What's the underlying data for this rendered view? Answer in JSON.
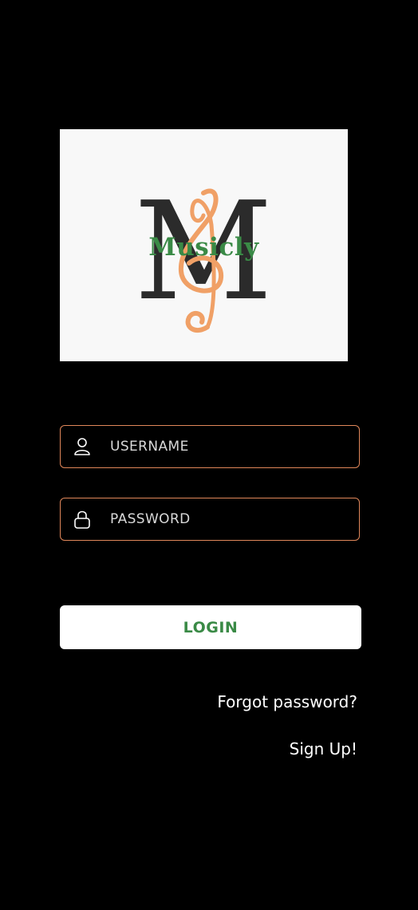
{
  "logo": {
    "monogram": "M",
    "wordmark": "Musicly",
    "colors": {
      "background": "#f8f8f8",
      "monogram": "#2b2b2b",
      "wordmark": "#3a8a46",
      "treble_clef": "#f0a066"
    },
    "icon": "treble-clef-icon"
  },
  "form": {
    "username": {
      "placeholder": "USERNAME",
      "value": "",
      "icon": "user-icon"
    },
    "password": {
      "placeholder": "PASSWORD",
      "value": "",
      "icon": "lock-icon"
    },
    "field_border_color": "#e0875a"
  },
  "actions": {
    "login_label": "LOGIN",
    "login_text_color": "#3a8a46",
    "forgot_password_label": "Forgot password?",
    "signup_label": "Sign Up!"
  }
}
